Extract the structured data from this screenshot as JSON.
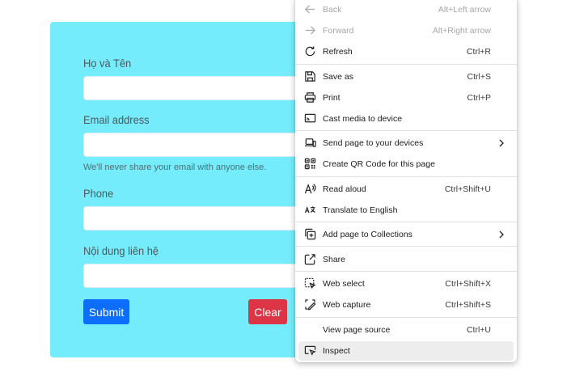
{
  "form": {
    "name_label": "Họ và Tên",
    "email_label": "Email address",
    "email_help": "We'll never share your email with anyone else.",
    "phone_label": "Phone",
    "content_label": "Nội dung liên hệ",
    "submit_label": "Submit",
    "clear_label": "Clear"
  },
  "colors": {
    "card_background": "#74ecfb",
    "submit_button": "#0d6efd",
    "clear_button": "#dc3545"
  },
  "menu": {
    "items": [
      {
        "label": "Back",
        "shortcut": "Alt+Left arrow",
        "icon": "back-arrow-icon",
        "disabled": true
      },
      {
        "label": "Forward",
        "shortcut": "Alt+Right arrow",
        "icon": "forward-arrow-icon",
        "disabled": true
      },
      {
        "label": "Refresh",
        "shortcut": "Ctrl+R",
        "icon": "refresh-icon"
      },
      {
        "label": "Save as",
        "shortcut": "Ctrl+S",
        "icon": "save-icon"
      },
      {
        "label": "Print",
        "shortcut": "Ctrl+P",
        "icon": "print-icon"
      },
      {
        "label": "Cast media to device",
        "shortcut": "",
        "icon": "cast-icon"
      },
      {
        "label": "Send page to your devices",
        "shortcut": "",
        "icon": "send-devices-icon",
        "submenu": true
      },
      {
        "label": "Create QR Code for this page",
        "shortcut": "",
        "icon": "qr-code-icon"
      },
      {
        "label": "Read aloud",
        "shortcut": "Ctrl+Shift+U",
        "icon": "read-aloud-icon"
      },
      {
        "label": "Translate to English",
        "shortcut": "",
        "icon": "translate-icon"
      },
      {
        "label": "Add page to Collections",
        "shortcut": "",
        "icon": "collections-icon",
        "submenu": true
      },
      {
        "label": "Share",
        "shortcut": "",
        "icon": "share-icon"
      },
      {
        "label": "Web select",
        "shortcut": "Ctrl+Shift+X",
        "icon": "web-select-icon"
      },
      {
        "label": "Web capture",
        "shortcut": "Ctrl+Shift+S",
        "icon": "web-capture-icon"
      },
      {
        "label": "View page source",
        "shortcut": "Ctrl+U",
        "icon": ""
      },
      {
        "label": "Inspect",
        "shortcut": "",
        "icon": "inspect-icon",
        "highlighted": true
      }
    ]
  }
}
